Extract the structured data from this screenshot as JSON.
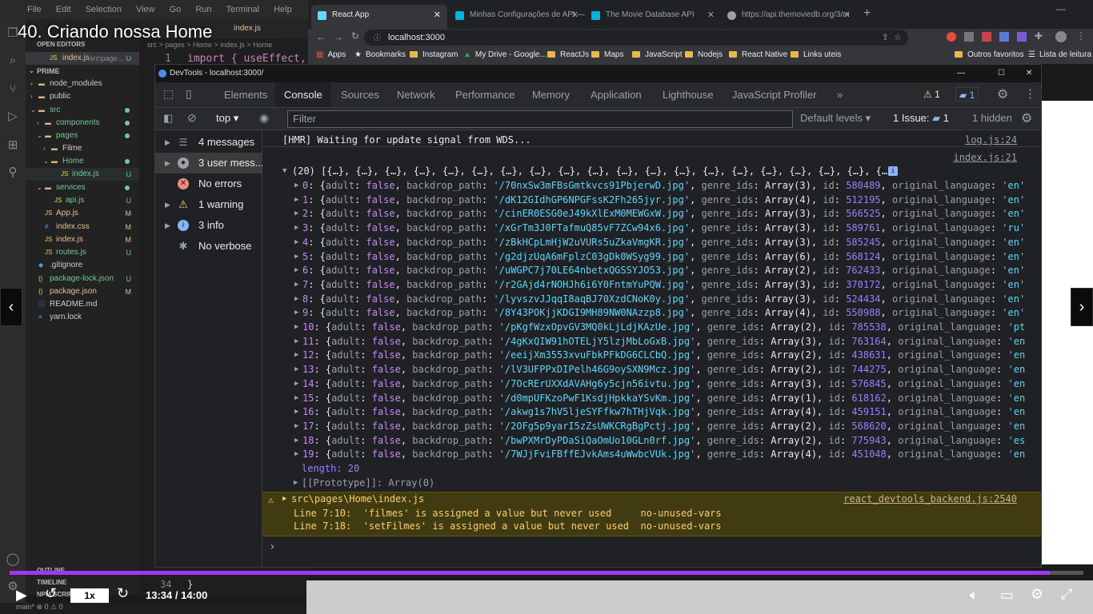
{
  "video": {
    "title": "40. Criando nossa Home",
    "speed": "1x",
    "time": "13:34 / 14:00",
    "progress": 0.969
  },
  "vscode": {
    "menu": [
      "File",
      "Edit",
      "Selection",
      "View",
      "Go",
      "Run",
      "Terminal",
      "Help"
    ],
    "open_editors_label": "OPEN EDITORS",
    "open_editor": {
      "name": "index.js",
      "path": "src\\page...",
      "status": "U"
    },
    "project_label": "PRIME",
    "tree": [
      {
        "name": "node_modules",
        "kind": "folder",
        "status": ""
      },
      {
        "name": "public",
        "kind": "folder",
        "status": ""
      },
      {
        "name": "src",
        "kind": "folder",
        "status": ""
      },
      {
        "name": "components",
        "kind": "folder",
        "status": ""
      },
      {
        "name": "pages",
        "kind": "folder",
        "status": ""
      },
      {
        "name": "Filme",
        "kind": "folder",
        "status": ""
      },
      {
        "name": "Home",
        "kind": "folder",
        "status": ""
      },
      {
        "name": "index.js",
        "kind": "js",
        "status": "U"
      },
      {
        "name": "services",
        "kind": "folder",
        "status": ""
      },
      {
        "name": "api.js",
        "kind": "js",
        "status": "U"
      },
      {
        "name": "App.js",
        "kind": "js",
        "status": "M"
      },
      {
        "name": "index.css",
        "kind": "css",
        "status": "M"
      },
      {
        "name": "index.js",
        "kind": "js",
        "status": "M"
      },
      {
        "name": "routes.js",
        "kind": "js",
        "status": "U"
      },
      {
        "name": ".gitignore",
        "kind": "git",
        "status": ""
      },
      {
        "name": "package-lock.json",
        "kind": "json",
        "status": "U"
      },
      {
        "name": "package.json",
        "kind": "json",
        "status": "M"
      },
      {
        "name": "README.md",
        "kind": "md",
        "status": ""
      },
      {
        "name": "yarn.lock",
        "kind": "lock",
        "status": ""
      }
    ],
    "outline_label": "OUTLINE",
    "timeline_label": "TIMELINE",
    "npm_label": "NPM SCRIPTS",
    "breadcrumb": "src > pages > Home > index.js > Home",
    "editor_tab": "index.js",
    "line_number": "1",
    "code_line": "import { useEffect,",
    "line_number_bottom": "34",
    "code_bottom": "}",
    "status_text": "main*  ⊗ 0 ⚠ 0"
  },
  "chrome": {
    "tabs": [
      {
        "title": "React App",
        "favicon_color": "#61dafb"
      },
      {
        "title": "Minhas Configurações de API —",
        "favicon_color": "#01b4e4"
      },
      {
        "title": "The Movie Database API",
        "favicon_color": "#01b4e4"
      },
      {
        "title": "https://api.themoviedb.org/3/m",
        "favicon_color": "#9aa0a6"
      }
    ],
    "new_tab": "+",
    "url": "localhost:3000",
    "bookmarks": [
      "Apps",
      "Bookmarks",
      "Instagram",
      "My Drive - Google...",
      "ReactJs",
      "Maps",
      "JavaScript",
      "Nodejs",
      "React Native",
      "Links uteis"
    ],
    "bookmarks_right": [
      "Outros favoritos",
      "Lista de leitura"
    ]
  },
  "devtools": {
    "window_title": "DevTools - localhost:3000/",
    "tabs": [
      "Elements",
      "Console",
      "Sources",
      "Network",
      "Performance",
      "Memory",
      "Application",
      "Lighthouse",
      "JavaScript Profiler"
    ],
    "active_tab": "Console",
    "warn_badge": "1",
    "msg_badge": "1",
    "context": "top",
    "filter_placeholder": "Filter",
    "levels": "Default levels",
    "issues": "1 Issue:",
    "issues_count": "1",
    "hidden": "1 hidden",
    "sidebar": [
      {
        "label": "4 messages",
        "icon": "list-icon"
      },
      {
        "label": "3 user mess...",
        "icon": "user-icon"
      },
      {
        "label": "No errors",
        "icon": "error-icon"
      },
      {
        "label": "1 warning",
        "icon": "warning-icon"
      },
      {
        "label": "3 info",
        "icon": "info-icon"
      },
      {
        "label": "No verbose",
        "icon": "bug-icon"
      }
    ],
    "console": {
      "hmr": "[HMR] Waiting for update signal from WDS...",
      "hmr_src": "log.js:24",
      "array_src": "index.js:21",
      "array_header": "(20) [{…}, {…}, {…}, {…}, {…}, {…}, {…}, {…}, {…}, {…}, {…}, {…}, {…}, {…}, {…}, {…}, {…}, {…}, {…}, {…}]",
      "items": [
        {
          "i": "0",
          "path": "'/70nxSw3mFBsGmtkvcs91PbjerwD.jpg'",
          "genres": "Array(3)",
          "id": "580489",
          "lang": "'en'"
        },
        {
          "i": "1",
          "path": "'/dK12GIdhGP6NPGFssK2Fh265jyr.jpg'",
          "genres": "Array(4)",
          "id": "512195",
          "lang": "'en'"
        },
        {
          "i": "2",
          "path": "'/cinER0ESG0eJ49kXlExM0MEWGxW.jpg'",
          "genres": "Array(3)",
          "id": "566525",
          "lang": "'en'"
        },
        {
          "i": "3",
          "path": "'/xGrTm3J0FTafmuQ85vF7ZCw94x6.jpg'",
          "genres": "Array(3)",
          "id": "589761",
          "lang": "'ru'"
        },
        {
          "i": "4",
          "path": "'/zBkHCpLmHjW2uVURs5uZkaVmgKR.jpg'",
          "genres": "Array(3)",
          "id": "585245",
          "lang": "'en'"
        },
        {
          "i": "5",
          "path": "'/g2djzUqA6mFplzC03gDk0WSyg99.jpg'",
          "genres": "Array(6)",
          "id": "568124",
          "lang": "'en'"
        },
        {
          "i": "6",
          "path": "'/uWGPC7j70LE64nbetxQGSSYJO53.jpg'",
          "genres": "Array(2)",
          "id": "762433",
          "lang": "'en'"
        },
        {
          "i": "7",
          "path": "'/r2GAjd4rNOHJh6i6Y0FntmYuPQW.jpg'",
          "genres": "Array(3)",
          "id": "370172",
          "lang": "'en'"
        },
        {
          "i": "8",
          "path": "'/lyvszvJJqqI8aqBJ70XzdCNoK0y.jpg'",
          "genres": "Array(3)",
          "id": "524434",
          "lang": "'en'"
        },
        {
          "i": "9",
          "path": "'/8Y43POKjjKDGI9MH89NW0NAzzp8.jpg'",
          "genres": "Array(4)",
          "id": "550988",
          "lang": "'en'"
        },
        {
          "i": "10",
          "path": "'/pKgfWzxOpvGV3MQ0kLjLdjKAzUe.jpg'",
          "genres": "Array(2)",
          "id": "785538",
          "lang": "'pt'"
        },
        {
          "i": "11",
          "path": "'/4gKxQIW91hOTELjY5lzjMbLoGxB.jpg'",
          "genres": "Array(3)",
          "id": "763164",
          "lang": "'en'"
        },
        {
          "i": "12",
          "path": "'/eeijXm3553xvuFbkPFkDG6CLCbQ.jpg'",
          "genres": "Array(2)",
          "id": "438631",
          "lang": "'en'"
        },
        {
          "i": "13",
          "path": "'/lV3UFPPxDIPelh46G9oySXN9Mcz.jpg'",
          "genres": "Array(2)",
          "id": "744275",
          "lang": "'en'"
        },
        {
          "i": "14",
          "path": "'/7OcRErUXXdAVAHg6y5cjn56ivtu.jpg'",
          "genres": "Array(3)",
          "id": "576845",
          "lang": "'en'"
        },
        {
          "i": "15",
          "path": "'/d0mpUFKzoPwF1KsdjHpkkaYSvKm.jpg'",
          "genres": "Array(1)",
          "id": "618162",
          "lang": "'en'"
        },
        {
          "i": "16",
          "path": "'/akwg1s7hV5ljeSYFfkw7hTHjVqk.jpg'",
          "genres": "Array(4)",
          "id": "459151",
          "lang": "'en'"
        },
        {
          "i": "17",
          "path": "'/2OFg5p9yarI5zZsUWKCRgBgPctj.jpg'",
          "genres": "Array(2)",
          "id": "568620",
          "lang": "'en'"
        },
        {
          "i": "18",
          "path": "'/bwPXMrDyPDaSiQaOmUo10GLn0rf.jpg'",
          "genres": "Array(2)",
          "id": "775943",
          "lang": "'es'"
        },
        {
          "i": "19",
          "path": "'/7WJjFviFBffEJvkAms4uWwbcVUk.jpg'",
          "genres": "Array(4)",
          "id": "451048",
          "lang": "'en'"
        }
      ],
      "length_line": "length: 20",
      "proto_line": "[[Prototype]]: Array(0)",
      "warn_file": "src\\pages\\Home\\index.js",
      "warn_src": "react_devtools_backend.js:2540",
      "warn_line1": "Line 7:10:  'filmes' is assigned a value but never used     no-unused-vars",
      "warn_line2": "Line 7:18:  'setFilmes' is assigned a value but never used  no-unused-vars",
      "prompt": "›"
    }
  }
}
